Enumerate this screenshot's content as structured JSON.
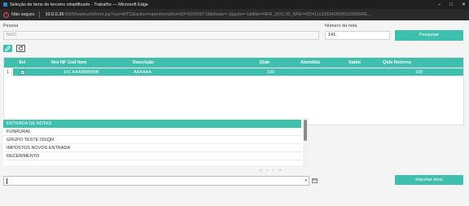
{
  "window": {
    "title": "Seleção de itens de terceiro simplificado - Trabalho — Microsoft Edge",
    "minimize": "–",
    "maximize": "□",
    "close": "✕"
  },
  "address": {
    "insecure_label": "Não seguro",
    "host": "10.0.0.36",
    "path": ":5000/webrun5/form.jsp?sys=MTC&action=openform&formID=500000718&mode=-1&goto=-1&filter=NFE_DOC.ID_NFE=43241113333426000109555RE..."
  },
  "form": {
    "pessoa_label": "Pessoa",
    "pessoa_value": "5693",
    "numero_nota_label": "Número da nota",
    "numero_nota_value": "141",
    "search_button": "Pesquisar",
    "import_button": "Importar itens"
  },
  "grid": {
    "columns": [
      "Sel",
      "Nro NF Cod Item",
      "Descrição",
      "Qtde",
      "Atendido",
      "Saldo",
      "Qtde Retorno"
    ],
    "rows": [
      {
        "num": "1",
        "sel": "✓",
        "nro": "141 AAABBBBBB",
        "descricao": "AAAAAA",
        "qtde": "100",
        "atendido": "",
        "saldo": "",
        "qtde_retorno": "100"
      }
    ]
  },
  "dropdown_options": [
    "ENTRADA DE NOTAS",
    "FUNRURAL",
    "GRUPO TESTE ISSQN",
    "IMPOSTOS NOVOS ENTRADA",
    "RECEBIMENTO"
  ],
  "selected_option_index": 0,
  "pager": {
    "first": "«",
    "prev": "‹",
    "next": "›",
    "last": "»"
  },
  "colors": {
    "accent": "#3fbfae",
    "titlebar": "#1f1f1f"
  }
}
